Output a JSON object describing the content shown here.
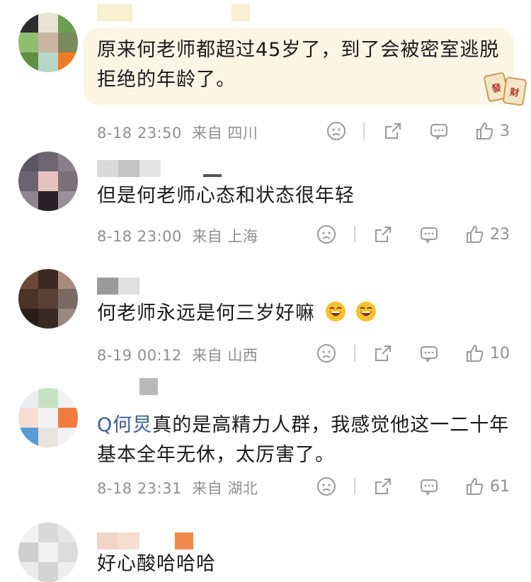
{
  "comments": [
    {
      "text": "原来何老师都超过45岁了，到了会被密室逃脱拒绝的年龄了。",
      "time": "8-18 23:50",
      "location": "来自 四川",
      "likes": "3",
      "badge": [
        "發",
        "财"
      ]
    },
    {
      "text": "但是何老师心态和状态很年轻",
      "time": "8-18 23:00",
      "location": "来自 上海",
      "likes": "23"
    },
    {
      "text": "何老师永远是何三岁好嘛",
      "time": "8-19 00:12",
      "location": "来自 山西",
      "likes": "10",
      "emojis": [
        "laughing-emoji",
        "laughing-emoji"
      ]
    },
    {
      "mention": "Q何炅",
      "text": "真的是高精力人群，我感觉他这一二十年基本全年无休，太厉害了。",
      "time": "8-18 23:31",
      "location": "来自 湖北",
      "likes": "61"
    },
    {
      "text": "好心酸哈哈哈"
    }
  ],
  "icons": {
    "dislike": "frown-icon",
    "share": "share-icon",
    "reply": "comment-icon",
    "like": "thumbs-up-icon"
  }
}
